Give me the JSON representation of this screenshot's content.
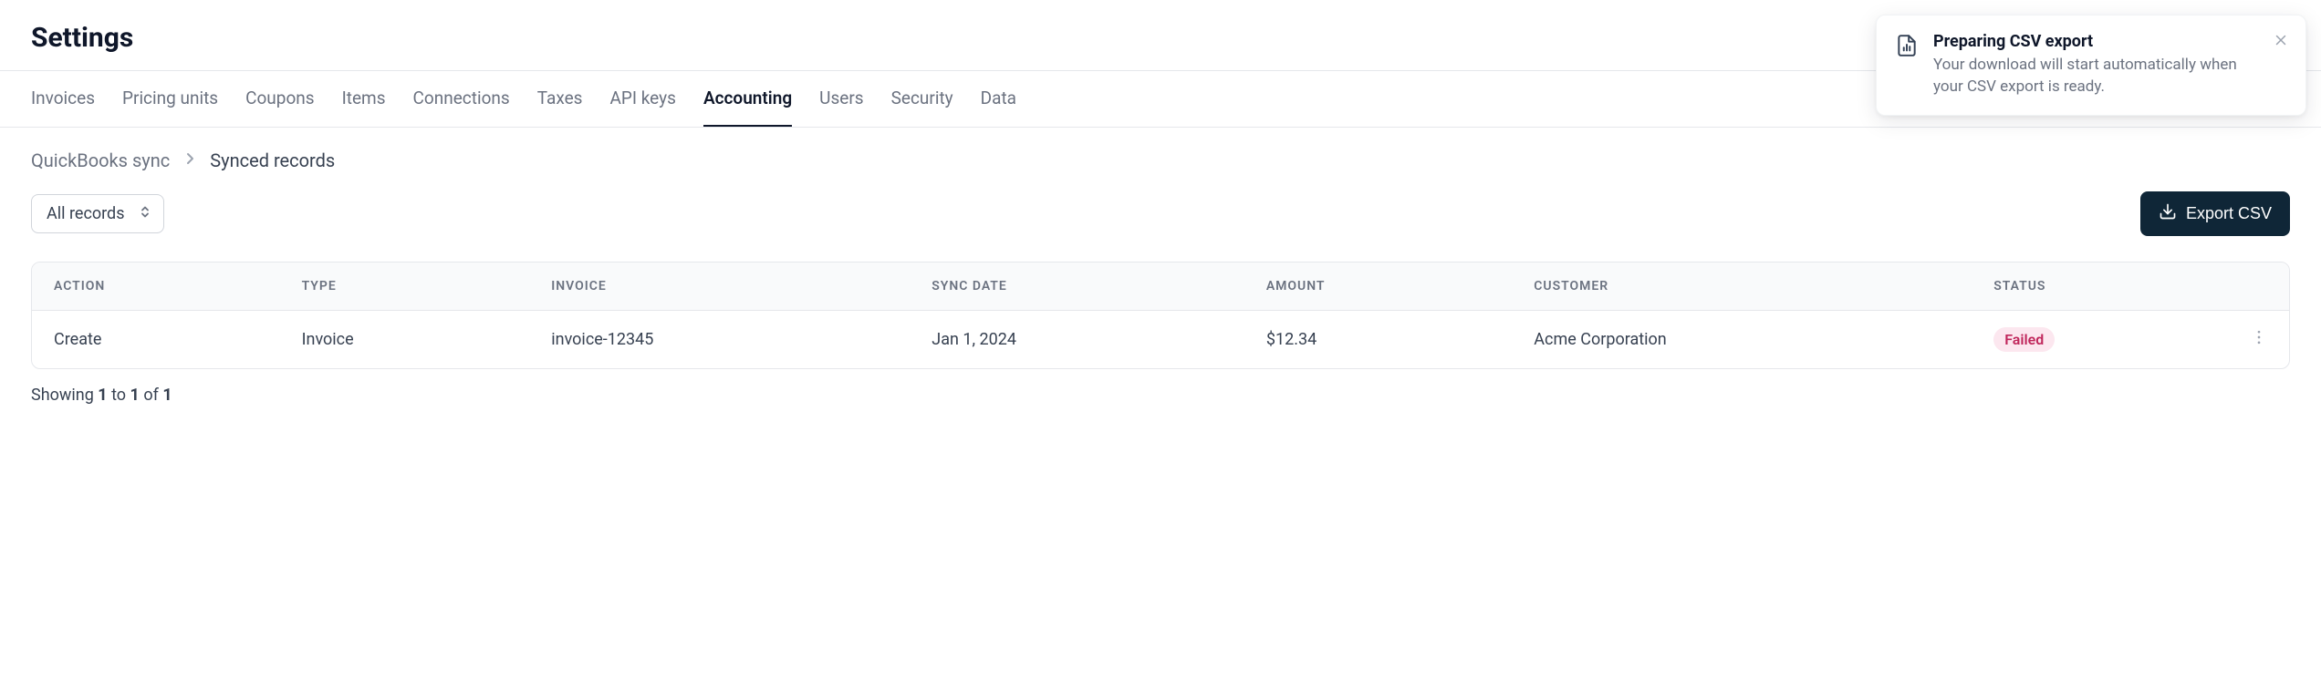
{
  "header": {
    "title": "Settings"
  },
  "tabs": {
    "items": [
      {
        "label": "Invoices"
      },
      {
        "label": "Pricing units"
      },
      {
        "label": "Coupons"
      },
      {
        "label": "Items"
      },
      {
        "label": "Connections"
      },
      {
        "label": "Taxes"
      },
      {
        "label": "API keys"
      },
      {
        "label": "Accounting"
      },
      {
        "label": "Users"
      },
      {
        "label": "Security"
      },
      {
        "label": "Data"
      }
    ],
    "activeIndex": 7
  },
  "breadcrumb": {
    "root": "QuickBooks sync",
    "current": "Synced records"
  },
  "filter": {
    "selected": "All records"
  },
  "exportButton": {
    "label": "Export CSV"
  },
  "table": {
    "headers": {
      "action": "ACTION",
      "type": "TYPE",
      "invoice": "INVOICE",
      "sync_date": "SYNC DATE",
      "amount": "AMOUNT",
      "customer": "CUSTOMER",
      "status": "STATUS"
    },
    "rows": [
      {
        "action": "Create",
        "type": "Invoice",
        "invoice": "invoice-12345",
        "sync_date": "Jan 1, 2024",
        "amount": "$12.34",
        "customer": "Acme Corporation",
        "status": "Failed"
      }
    ]
  },
  "pagination": {
    "prefix": "Showing ",
    "from": "1",
    "mid1": " to ",
    "to": "1",
    "mid2": " of ",
    "total": "1"
  },
  "toast": {
    "title": "Preparing CSV export",
    "description": "Your download will start automatically when your CSV export is ready."
  }
}
